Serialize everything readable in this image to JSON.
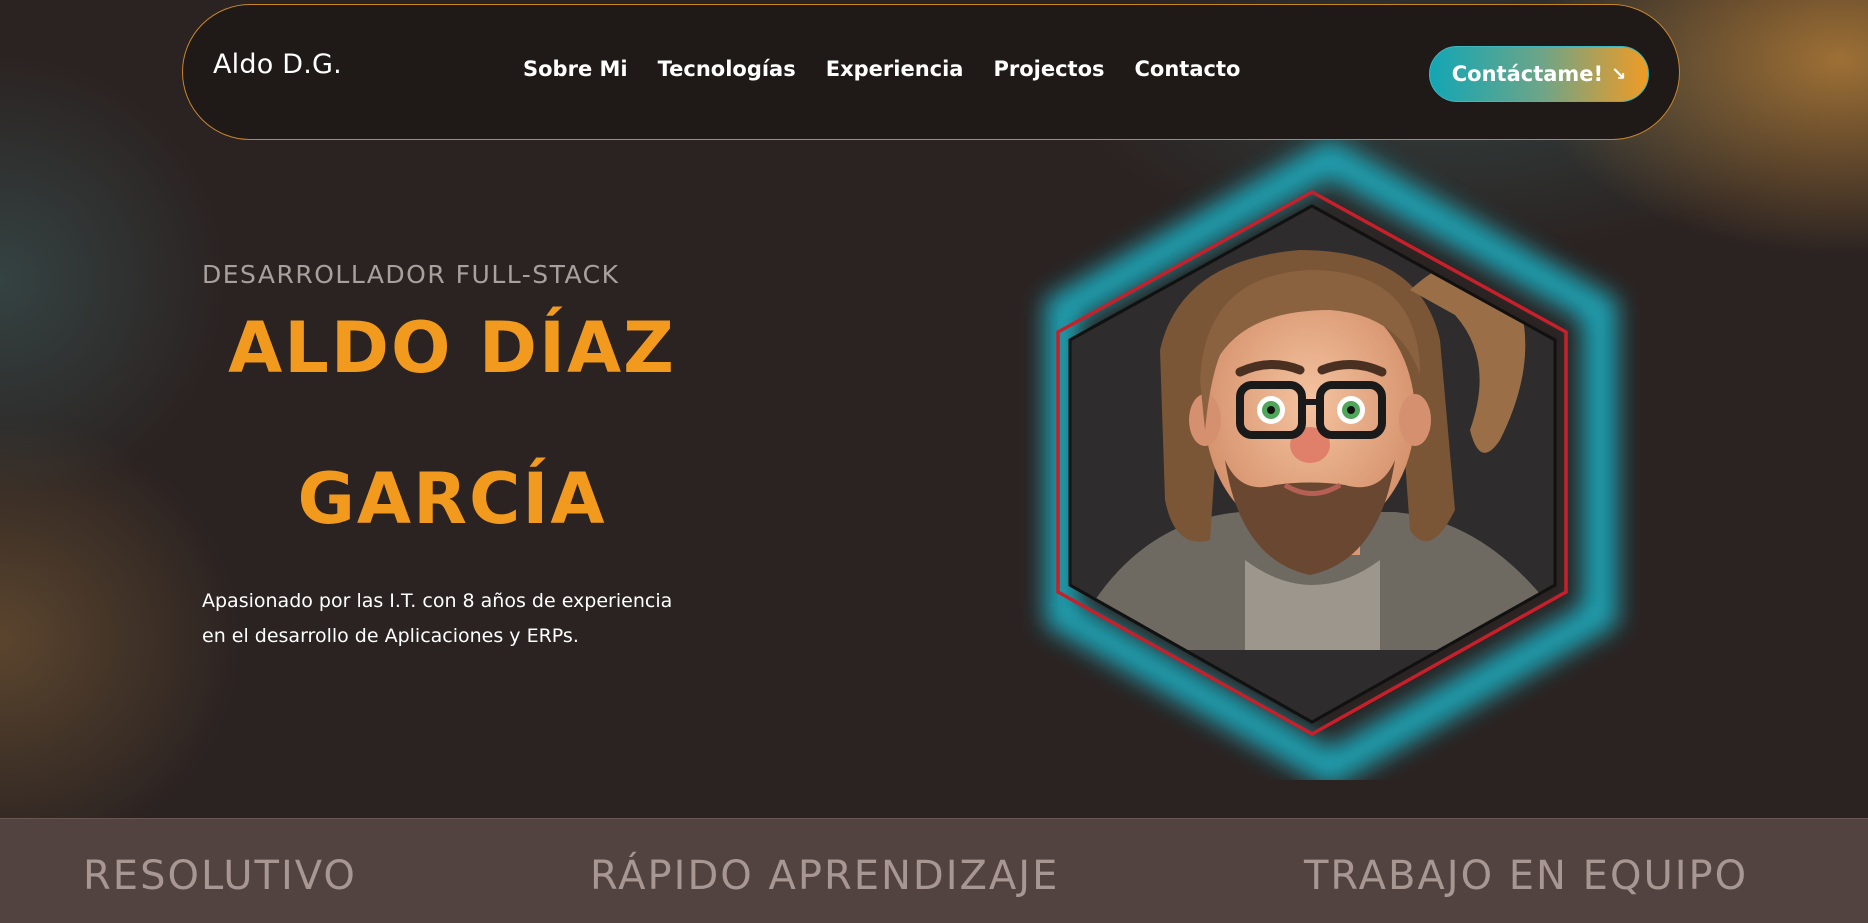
{
  "navbar": {
    "logo": "Aldo D.G.",
    "links": [
      "Sobre Mi",
      "Tecnologías",
      "Experiencia",
      "Projectos",
      "Contacto"
    ],
    "cta_label": "Contáctame!",
    "cta_icon": "arrow-down-right-icon"
  },
  "hero": {
    "role": "DESARROLLADOR FULL-STACK",
    "name_line1": "ALDO DÍAZ",
    "name_line2": "GARCÍA",
    "desc_line1": "Apasionado por las I.T. con 8 años de experiencia",
    "desc_line2": "en el desarrollo de Aplicaciones y ERPs.",
    "avatar": "cartoon-avatar-portrait"
  },
  "skills": [
    "RESOLUTIVO",
    "RÁPIDO APRENDIZAJE",
    "TRABAJO EN EQUIPO"
  ],
  "colors": {
    "accent_orange": "#f29a1d",
    "accent_teal": "#1fa9bb",
    "hex_red": "#c8202a",
    "background": "#2b2322"
  }
}
